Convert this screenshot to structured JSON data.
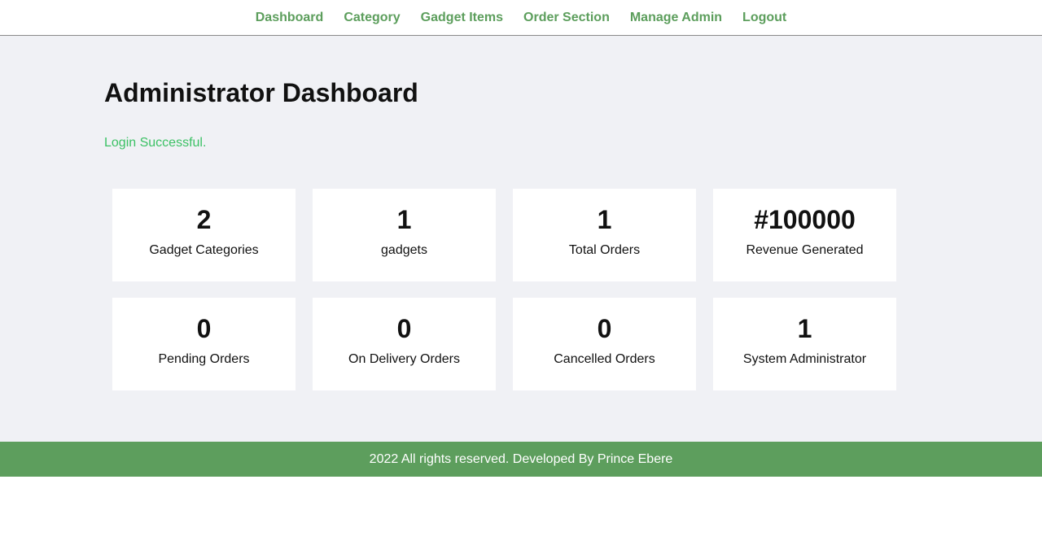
{
  "nav": {
    "items": [
      {
        "label": "Dashboard"
      },
      {
        "label": "Category"
      },
      {
        "label": "Gadget Items"
      },
      {
        "label": "Order Section"
      },
      {
        "label": "Manage Admin"
      },
      {
        "label": "Logout"
      }
    ]
  },
  "main": {
    "title": "Administrator Dashboard",
    "notice": "Login Successful."
  },
  "cards": [
    {
      "value": "2",
      "label": "Gadget Categories"
    },
    {
      "value": "1",
      "label": "gadgets"
    },
    {
      "value": "1",
      "label": "Total Orders"
    },
    {
      "value": "#100000",
      "label": "Revenue Generated"
    },
    {
      "value": "0",
      "label": "Pending Orders"
    },
    {
      "value": "0",
      "label": "On Delivery Orders"
    },
    {
      "value": "0",
      "label": "Cancelled Orders"
    },
    {
      "value": "1",
      "label": "System Administrator"
    }
  ],
  "footer": {
    "text": "2022 All rights reserved. Developed By Prince Ebere"
  },
  "colors": {
    "accent_green": "#5d9e5d",
    "success_text": "#3cc165",
    "main_bg": "#f0f1f5"
  }
}
